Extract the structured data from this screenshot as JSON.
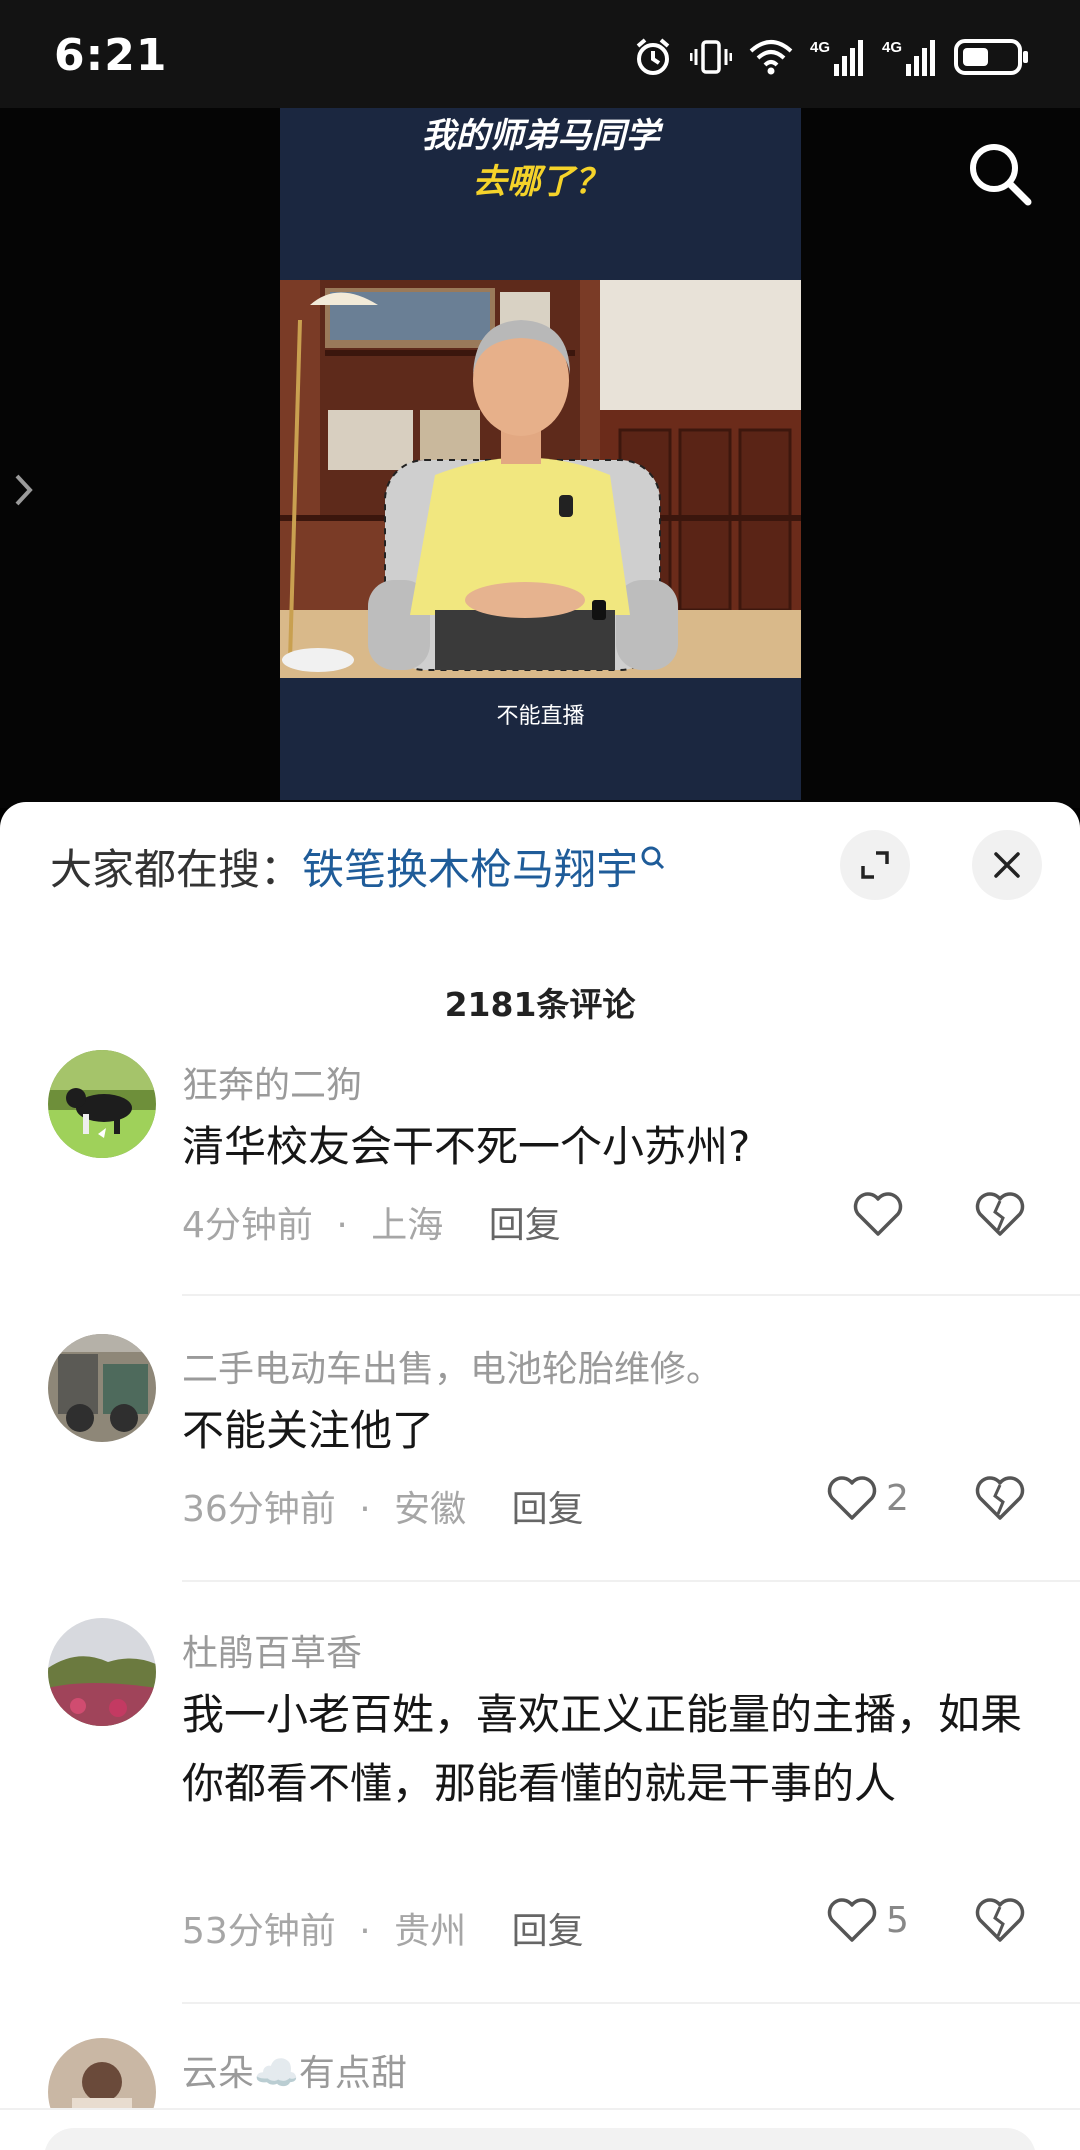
{
  "status_bar": {
    "time": "6:21",
    "network_1": "4G",
    "network_2": "4G"
  },
  "video": {
    "title_line1": "我的师弟马同学",
    "title_line2": "去哪了？",
    "caption": "不能直播"
  },
  "hot_search": {
    "prefix": "大家都在搜：",
    "query": "铁笔换木枪马翔宇"
  },
  "comments_header": {
    "count_label": "2181条评论"
  },
  "comments": [
    {
      "username": "狂奔的二狗",
      "text": "清华校友会干不死一个小苏州?",
      "time": "4分钟前",
      "location": "上海",
      "reply": "回复",
      "likes": ""
    },
    {
      "username": "二手电动车出售，电池轮胎维修。",
      "text": "不能关注他了",
      "time": "36分钟前",
      "location": "安徽",
      "reply": "回复",
      "likes": "2"
    },
    {
      "username": "杜鹃百草香",
      "text": "我一小老百姓，喜欢正义正能量的主播，如果你都看不懂，那能看懂的就是干事的人",
      "time": "53分钟前",
      "location": "贵州",
      "reply": "回复",
      "likes": "5"
    },
    {
      "username": "云朵☁️有点甜",
      "text": "",
      "time": "",
      "location": "",
      "reply": "",
      "likes": ""
    }
  ],
  "meta_separator": "·",
  "colors": {
    "link": "#1f5c99",
    "caption_yellow": "#f5d32a",
    "sheet_bg": "#ffffff"
  }
}
